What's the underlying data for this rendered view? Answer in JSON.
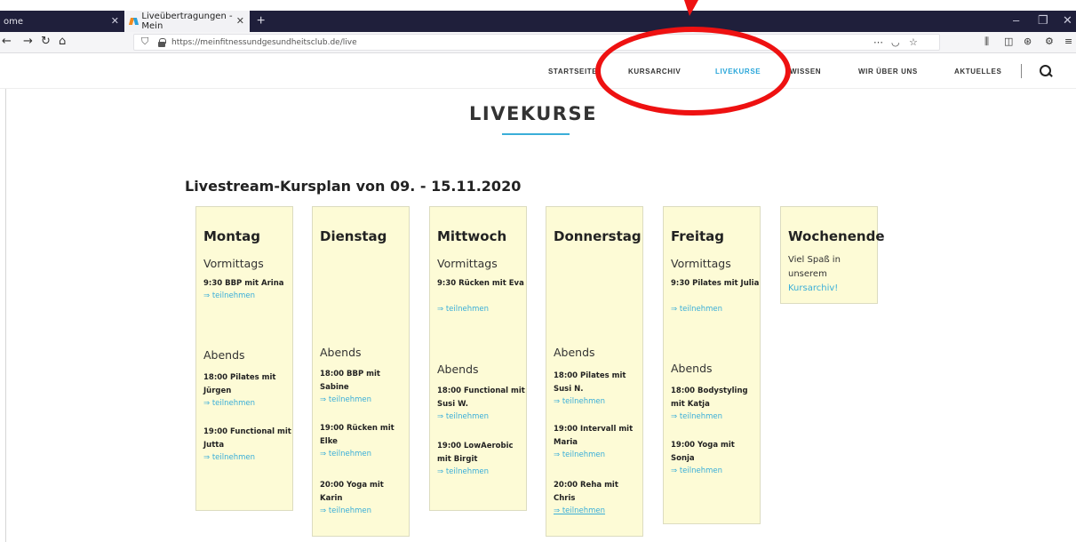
{
  "browser": {
    "prev_tab_label": "ome",
    "active_tab_label": "Liveübertragungen - Mein",
    "url": "https://meinfitnessundgesundheitsclub.de/live",
    "more_icon": "⋯"
  },
  "site": {
    "nav": [
      "STARTSEITE",
      "KURSARCHIV",
      "LIVEKURSE",
      "WISSEN",
      "WIR ÜBER UNS",
      "AKTUELLES"
    ],
    "active_nav": "LIVEKURSE"
  },
  "page": {
    "title": "LIVEKURSE",
    "schedule_title": "Livestream-Kursplan von 09. - 15.11.2020"
  },
  "days": [
    {
      "name": "Montag",
      "morning_label": "Vormittags",
      "morning": [
        {
          "course": "9:30 BBP mit Arina",
          "link": "⇒ teilnehmen"
        }
      ],
      "evening_label": "Abends",
      "evening": [
        {
          "course": "18:00 Pilates mit Jürgen",
          "link": "⇒ teilnehmen"
        },
        {
          "course": "19:00 Functional mit Jutta",
          "link": "⇒ teilnehmen"
        }
      ]
    },
    {
      "name": "Dienstag",
      "evening_label": "Abends",
      "evening": [
        {
          "course": "18:00 BBP mit Sabine",
          "link": "⇒ teilnehmen"
        },
        {
          "course": "19:00 Rücken mit Elke",
          "link": "⇒ teilnehmen"
        },
        {
          "course": "20:00 Yoga mit Karin",
          "link": "⇒ teilnehmen"
        }
      ]
    },
    {
      "name": "Mittwoch",
      "morning_label": "Vormittags",
      "morning": [
        {
          "course": "9:30 Rücken mit Eva",
          "link": "⇒ teilnehmen"
        }
      ],
      "evening_label": "Abends",
      "evening": [
        {
          "course": "18:00 Functional mit Susi W.",
          "link": "⇒ teilnehmen"
        },
        {
          "course": "19:00 LowAerobic mit Birgit",
          "link": "⇒ teilnehmen"
        }
      ]
    },
    {
      "name": "Donnerstag",
      "evening_label": "Abends",
      "evening": [
        {
          "course": "18:00 Pilates mit Susi N.",
          "link": "⇒ teilnehmen"
        },
        {
          "course": "19:00 Intervall mit Maria",
          "link": "⇒ teilnehmen"
        },
        {
          "course": "20:00 Reha mit Chris",
          "link": "⇒ teilnehmen"
        }
      ]
    },
    {
      "name": "Freitag",
      "morning_label": "Vormittags",
      "morning": [
        {
          "course": "9:30 Pilates mit Julia",
          "link": "⇒ teilnehmen"
        }
      ],
      "evening_label": "Abends",
      "evening": [
        {
          "course": "18:00 Bodystyling mit Katja",
          "link": "⇒ teilnehmen"
        },
        {
          "course": "19:00 Yoga mit Sonja",
          "link": "⇒ teilnehmen"
        }
      ]
    },
    {
      "name": "Wochenende",
      "text": "Viel Spaß in unserem",
      "link": "Kursarchiv!"
    }
  ],
  "colors": {
    "accent": "#29a6d9",
    "card_bg": "#fdfbd6",
    "annotation": "#ee1111",
    "tabbar": "#1f1f3b"
  }
}
